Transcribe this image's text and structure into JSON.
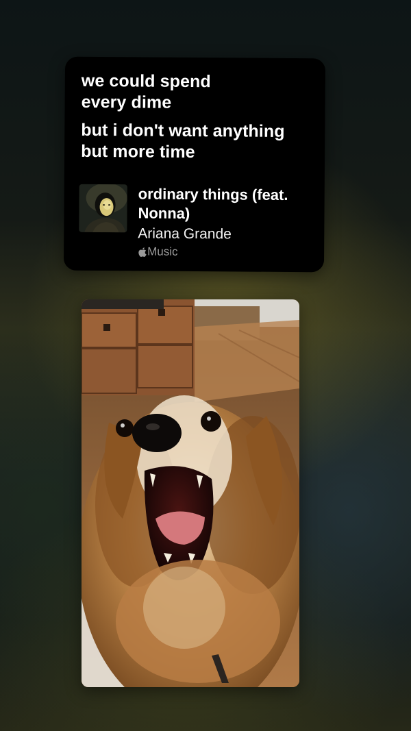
{
  "lyrics": {
    "lines": [
      "we could spend",
      "every dime",
      "but i don't want anything",
      "but more time"
    ]
  },
  "song": {
    "title": "ordinary things (feat. Nonna)",
    "artist": "Ariana Grande",
    "service": "Music",
    "service_icon": "apple-logo-icon",
    "album_art_icon": "album-art-portrait"
  },
  "photo": {
    "subject": "dog-photo"
  }
}
